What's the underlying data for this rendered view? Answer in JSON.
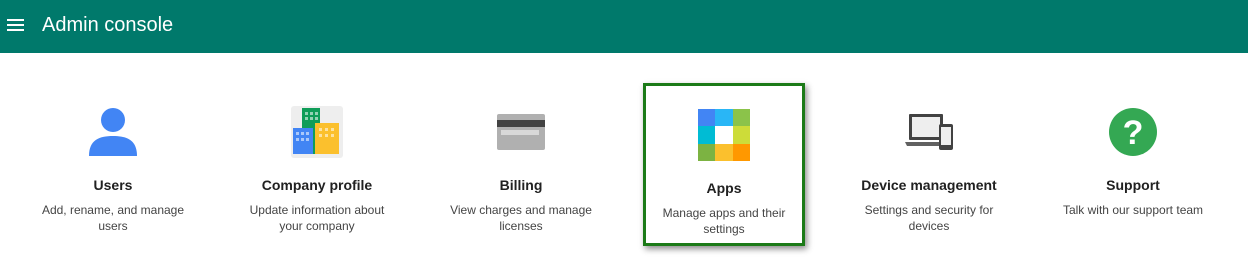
{
  "header": {
    "title": "Admin console"
  },
  "colors": {
    "header_bg": "#00796b",
    "highlight_border": "#1b7a17"
  },
  "cards": [
    {
      "title": "Users",
      "description": "Add, rename, and manage users",
      "icon": "users-icon"
    },
    {
      "title": "Company profile",
      "description": "Update information about your company",
      "icon": "company-profile-icon"
    },
    {
      "title": "Billing",
      "description": "View charges and manage licenses",
      "icon": "billing-icon"
    },
    {
      "title": "Apps",
      "description": "Manage apps and their settings",
      "icon": "apps-icon",
      "highlighted": true
    },
    {
      "title": "Device management",
      "description": "Settings and security for devices",
      "icon": "device-management-icon"
    },
    {
      "title": "Support",
      "description": "Talk with our support team",
      "icon": "support-icon"
    }
  ]
}
